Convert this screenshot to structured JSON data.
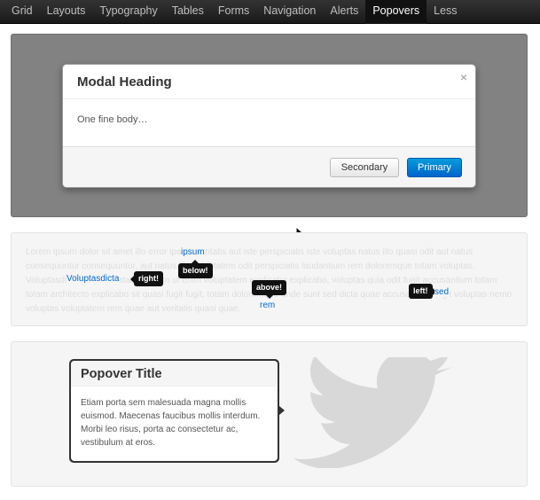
{
  "nav": {
    "items": [
      {
        "label": "Grid"
      },
      {
        "label": "Layouts"
      },
      {
        "label": "Typography"
      },
      {
        "label": "Tables"
      },
      {
        "label": "Forms"
      },
      {
        "label": "Navigation"
      },
      {
        "label": "Alerts"
      },
      {
        "label": "Popovers"
      },
      {
        "label": "Less"
      }
    ],
    "active": "Popovers"
  },
  "modal": {
    "title": "Modal Heading",
    "close_glyph": "×",
    "body": "One fine body…",
    "secondary_label": "Secondary",
    "primary_label": "Primary"
  },
  "twipsy": {
    "lorem": "Lorem ipsum dolor sit amet illo error ipsum veritatis aut iste perspiciatis iste voluptas natus illo quasi odit aut natus consequuntur consequuntur, aut natus illo voluptatem odit perspiciatis laudantium rem doloremque totam voluptas. Voluptasdicta eaque beatae aperiam ut enim voluptatem explicabo explicabo, voluptas quia odit fugit accusantium totam totam architecto explicabo sit quasi fugit fugit, totam doloremque unde sunt sed dicta quae accusantium fugit voluptas nemo voluptas voluptatem rem quae aut veritatis quasi quae.",
    "links": {
      "ipsum": "ipsum",
      "voluptasdicta": "Voluptasdicta",
      "sed": "sed",
      "rem": "rem"
    },
    "tips": {
      "below": "below!",
      "right": "right!",
      "above": "above!",
      "left": "left!"
    }
  },
  "popover": {
    "title": "Popover Title",
    "content": "Etiam porta sem malesuada magna mollis euismod. Maecenas faucibus mollis interdum. Morbi leo risus, porta ac consectetur ac, vestibulum at eros."
  },
  "colors": {
    "navbar": "#222222",
    "primary": "#0064cd",
    "link": "#0069d6",
    "well": "#f5f5f5",
    "modal_backdrop": "#828282"
  }
}
